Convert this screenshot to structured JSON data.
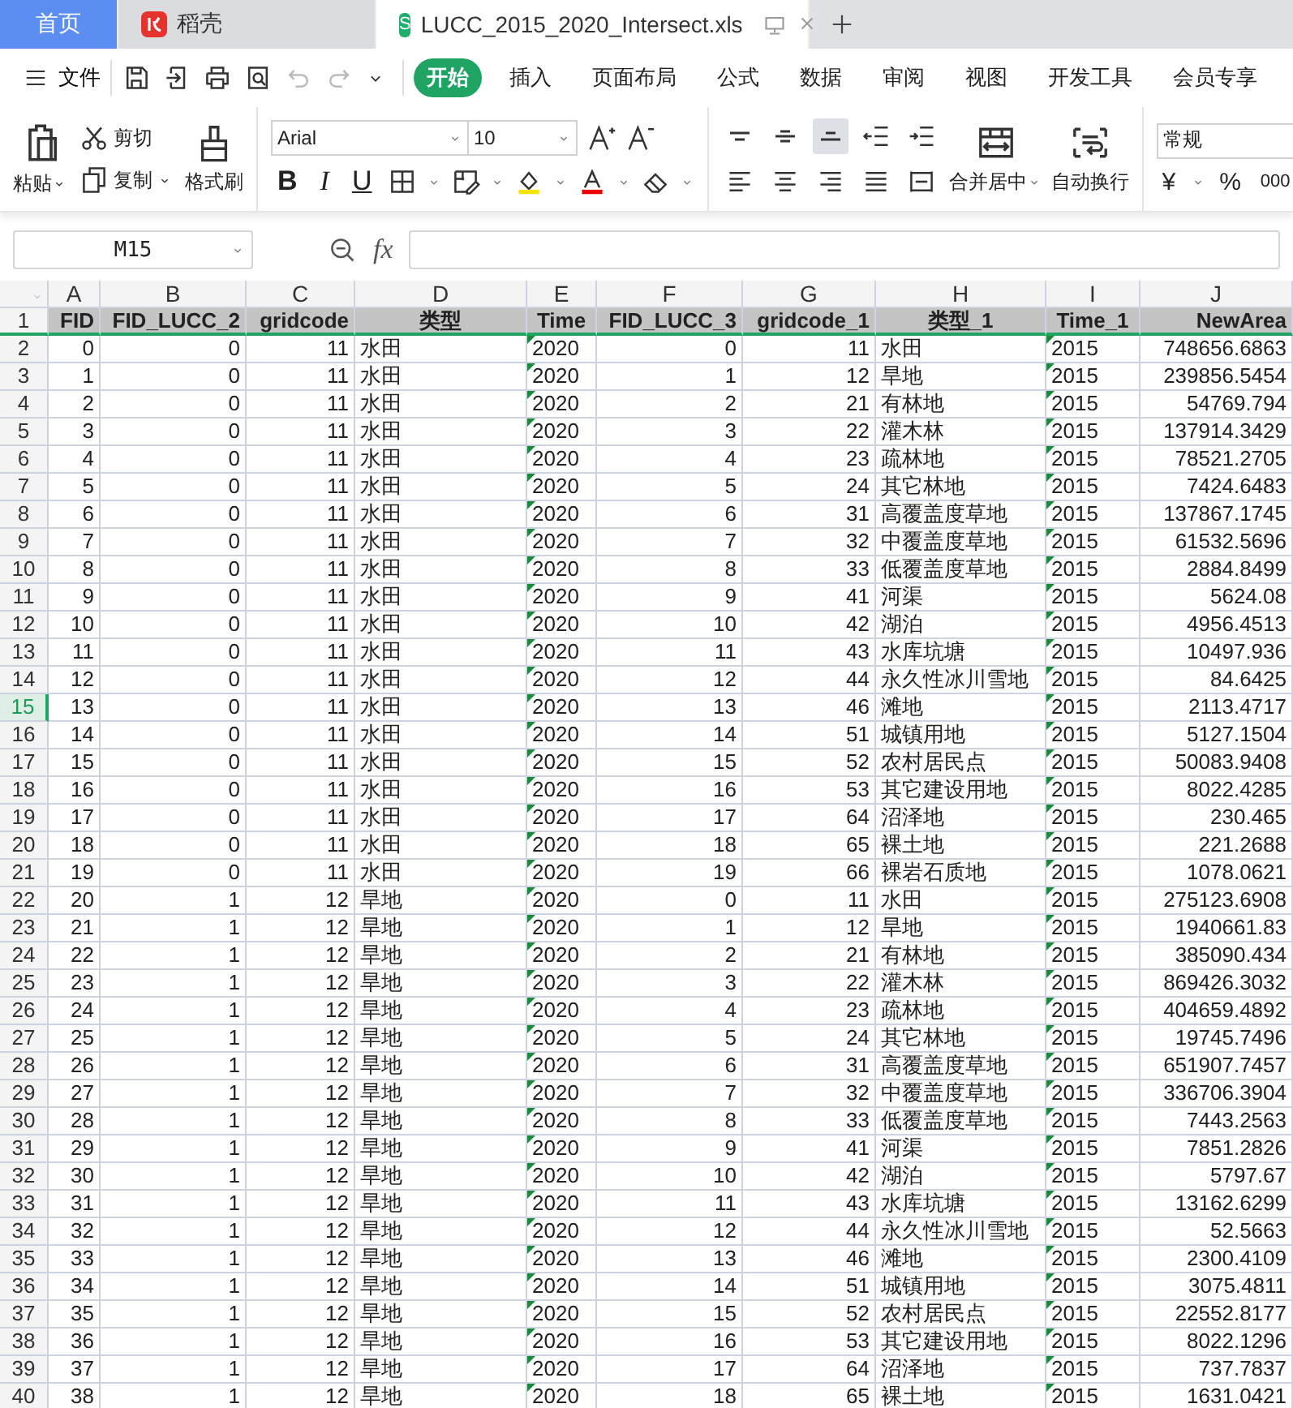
{
  "tabs": [
    {
      "label": "首页",
      "kind": "home",
      "selected": false
    },
    {
      "label": "稻壳",
      "kind": "app",
      "selected": false
    },
    {
      "label": "LUCC_2015_2020_Intersect.xls",
      "kind": "file",
      "badge": "S",
      "selected": true
    }
  ],
  "menu": {
    "file_label": "文件",
    "items": [
      {
        "label": "开始",
        "selected": true
      },
      {
        "label": "插入",
        "selected": false
      },
      {
        "label": "页面布局",
        "selected": false
      },
      {
        "label": "公式",
        "selected": false
      },
      {
        "label": "数据",
        "selected": false
      },
      {
        "label": "审阅",
        "selected": false
      },
      {
        "label": "视图",
        "selected": false
      },
      {
        "label": "开发工具",
        "selected": false
      },
      {
        "label": "会员专享",
        "selected": false
      }
    ]
  },
  "ribbon": {
    "paste": "粘贴",
    "cut": "剪切",
    "copy": "复制",
    "format_painter": "格式刷",
    "font": "Arial",
    "size": "10",
    "style_buttons": [
      "B",
      "I",
      "U"
    ],
    "align_buttons": [
      {
        "kind": "top",
        "on": false
      },
      {
        "kind": "middle",
        "on": false
      },
      {
        "kind": "bottom",
        "on": true
      },
      {
        "kind": "outdent",
        "on": false
      },
      {
        "kind": "indent",
        "on": false
      }
    ],
    "merge": "合并居中",
    "wrap": "自动换行",
    "number_format": "常规",
    "currency": "¥",
    "percent": "%",
    "thousands": "000"
  },
  "formula_bar": {
    "name_box": "M15",
    "fx_label": "fx"
  },
  "sheet": {
    "columns": [
      {
        "letter": "A",
        "header": "FID",
        "kind": "number"
      },
      {
        "letter": "B",
        "header": "FID_LUCC_2",
        "kind": "number"
      },
      {
        "letter": "C",
        "header": "gridcode",
        "kind": "number"
      },
      {
        "letter": "D",
        "header": "类型",
        "kind": "text"
      },
      {
        "letter": "E",
        "header": "Time",
        "kind": "text_number"
      },
      {
        "letter": "F",
        "header": "FID_LUCC_3",
        "kind": "number"
      },
      {
        "letter": "G",
        "header": "gridcode_1",
        "kind": "number"
      },
      {
        "letter": "H",
        "header": "类型_1",
        "kind": "text"
      },
      {
        "letter": "I",
        "header": "Time_1",
        "kind": "text_number"
      },
      {
        "letter": "J",
        "header": "NewArea",
        "kind": "number"
      }
    ],
    "header_row_number": "1",
    "rows": [
      {
        "number": "2",
        "selected": false,
        "cells": [
          "0",
          "0",
          "11",
          "水田",
          "2020",
          "0",
          "11",
          "水田",
          "2015",
          "748656.6863"
        ]
      },
      {
        "number": "3",
        "selected": false,
        "cells": [
          "1",
          "0",
          "11",
          "水田",
          "2020",
          "1",
          "12",
          "旱地",
          "2015",
          "239856.5454"
        ]
      },
      {
        "number": "4",
        "selected": false,
        "cells": [
          "2",
          "0",
          "11",
          "水田",
          "2020",
          "2",
          "21",
          "有林地",
          "2015",
          "54769.794"
        ]
      },
      {
        "number": "5",
        "selected": false,
        "cells": [
          "3",
          "0",
          "11",
          "水田",
          "2020",
          "3",
          "22",
          "灌木林",
          "2015",
          "137914.3429"
        ]
      },
      {
        "number": "6",
        "selected": false,
        "cells": [
          "4",
          "0",
          "11",
          "水田",
          "2020",
          "4",
          "23",
          "疏林地",
          "2015",
          "78521.2705"
        ]
      },
      {
        "number": "7",
        "selected": false,
        "cells": [
          "5",
          "0",
          "11",
          "水田",
          "2020",
          "5",
          "24",
          "其它林地",
          "2015",
          "7424.6483"
        ]
      },
      {
        "number": "8",
        "selected": false,
        "cells": [
          "6",
          "0",
          "11",
          "水田",
          "2020",
          "6",
          "31",
          "高覆盖度草地",
          "2015",
          "137867.1745"
        ]
      },
      {
        "number": "9",
        "selected": false,
        "cells": [
          "7",
          "0",
          "11",
          "水田",
          "2020",
          "7",
          "32",
          "中覆盖度草地",
          "2015",
          "61532.5696"
        ]
      },
      {
        "number": "10",
        "selected": false,
        "cells": [
          "8",
          "0",
          "11",
          "水田",
          "2020",
          "8",
          "33",
          "低覆盖度草地",
          "2015",
          "2884.8499"
        ]
      },
      {
        "number": "11",
        "selected": false,
        "cells": [
          "9",
          "0",
          "11",
          "水田",
          "2020",
          "9",
          "41",
          "河渠",
          "2015",
          "5624.08"
        ]
      },
      {
        "number": "12",
        "selected": false,
        "cells": [
          "10",
          "0",
          "11",
          "水田",
          "2020",
          "10",
          "42",
          "湖泊",
          "2015",
          "4956.4513"
        ]
      },
      {
        "number": "13",
        "selected": false,
        "cells": [
          "11",
          "0",
          "11",
          "水田",
          "2020",
          "11",
          "43",
          "水库坑塘",
          "2015",
          "10497.936"
        ]
      },
      {
        "number": "14",
        "selected": false,
        "cells": [
          "12",
          "0",
          "11",
          "水田",
          "2020",
          "12",
          "44",
          "永久性冰川雪地",
          "2015",
          "84.6425"
        ]
      },
      {
        "number": "15",
        "selected": true,
        "cells": [
          "13",
          "0",
          "11",
          "水田",
          "2020",
          "13",
          "46",
          "滩地",
          "2015",
          "2113.4717"
        ]
      },
      {
        "number": "16",
        "selected": false,
        "cells": [
          "14",
          "0",
          "11",
          "水田",
          "2020",
          "14",
          "51",
          "城镇用地",
          "2015",
          "5127.1504"
        ]
      },
      {
        "number": "17",
        "selected": false,
        "cells": [
          "15",
          "0",
          "11",
          "水田",
          "2020",
          "15",
          "52",
          "农村居民点",
          "2015",
          "50083.9408"
        ]
      },
      {
        "number": "18",
        "selected": false,
        "cells": [
          "16",
          "0",
          "11",
          "水田",
          "2020",
          "16",
          "53",
          "其它建设用地",
          "2015",
          "8022.4285"
        ]
      },
      {
        "number": "19",
        "selected": false,
        "cells": [
          "17",
          "0",
          "11",
          "水田",
          "2020",
          "17",
          "64",
          "沼泽地",
          "2015",
          "230.465"
        ]
      },
      {
        "number": "20",
        "selected": false,
        "cells": [
          "18",
          "0",
          "11",
          "水田",
          "2020",
          "18",
          "65",
          "裸土地",
          "2015",
          "221.2688"
        ]
      },
      {
        "number": "21",
        "selected": false,
        "cells": [
          "19",
          "0",
          "11",
          "水田",
          "2020",
          "19",
          "66",
          "裸岩石质地",
          "2015",
          "1078.0621"
        ]
      },
      {
        "number": "22",
        "selected": false,
        "cells": [
          "20",
          "1",
          "12",
          "旱地",
          "2020",
          "0",
          "11",
          "水田",
          "2015",
          "275123.6908"
        ]
      },
      {
        "number": "23",
        "selected": false,
        "cells": [
          "21",
          "1",
          "12",
          "旱地",
          "2020",
          "1",
          "12",
          "旱地",
          "2015",
          "1940661.83"
        ]
      },
      {
        "number": "24",
        "selected": false,
        "cells": [
          "22",
          "1",
          "12",
          "旱地",
          "2020",
          "2",
          "21",
          "有林地",
          "2015",
          "385090.434"
        ]
      },
      {
        "number": "25",
        "selected": false,
        "cells": [
          "23",
          "1",
          "12",
          "旱地",
          "2020",
          "3",
          "22",
          "灌木林",
          "2015",
          "869426.3032"
        ]
      },
      {
        "number": "26",
        "selected": false,
        "cells": [
          "24",
          "1",
          "12",
          "旱地",
          "2020",
          "4",
          "23",
          "疏林地",
          "2015",
          "404659.4892"
        ]
      },
      {
        "number": "27",
        "selected": false,
        "cells": [
          "25",
          "1",
          "12",
          "旱地",
          "2020",
          "5",
          "24",
          "其它林地",
          "2015",
          "19745.7496"
        ]
      },
      {
        "number": "28",
        "selected": false,
        "cells": [
          "26",
          "1",
          "12",
          "旱地",
          "2020",
          "6",
          "31",
          "高覆盖度草地",
          "2015",
          "651907.7457"
        ]
      },
      {
        "number": "29",
        "selected": false,
        "cells": [
          "27",
          "1",
          "12",
          "旱地",
          "2020",
          "7",
          "32",
          "中覆盖度草地",
          "2015",
          "336706.3904"
        ]
      },
      {
        "number": "30",
        "selected": false,
        "cells": [
          "28",
          "1",
          "12",
          "旱地",
          "2020",
          "8",
          "33",
          "低覆盖度草地",
          "2015",
          "7443.2563"
        ]
      },
      {
        "number": "31",
        "selected": false,
        "cells": [
          "29",
          "1",
          "12",
          "旱地",
          "2020",
          "9",
          "41",
          "河渠",
          "2015",
          "7851.2826"
        ]
      },
      {
        "number": "32",
        "selected": false,
        "cells": [
          "30",
          "1",
          "12",
          "旱地",
          "2020",
          "10",
          "42",
          "湖泊",
          "2015",
          "5797.67"
        ]
      },
      {
        "number": "33",
        "selected": false,
        "cells": [
          "31",
          "1",
          "12",
          "旱地",
          "2020",
          "11",
          "43",
          "水库坑塘",
          "2015",
          "13162.6299"
        ]
      },
      {
        "number": "34",
        "selected": false,
        "cells": [
          "32",
          "1",
          "12",
          "旱地",
          "2020",
          "12",
          "44",
          "永久性冰川雪地",
          "2015",
          "52.5663"
        ]
      },
      {
        "number": "35",
        "selected": false,
        "cells": [
          "33",
          "1",
          "12",
          "旱地",
          "2020",
          "13",
          "46",
          "滩地",
          "2015",
          "2300.4109"
        ]
      },
      {
        "number": "36",
        "selected": false,
        "cells": [
          "34",
          "1",
          "12",
          "旱地",
          "2020",
          "14",
          "51",
          "城镇用地",
          "2015",
          "3075.4811"
        ]
      },
      {
        "number": "37",
        "selected": false,
        "cells": [
          "35",
          "1",
          "12",
          "旱地",
          "2020",
          "15",
          "52",
          "农村居民点",
          "2015",
          "22552.8177"
        ]
      },
      {
        "number": "38",
        "selected": false,
        "cells": [
          "36",
          "1",
          "12",
          "旱地",
          "2020",
          "16",
          "53",
          "其它建设用地",
          "2015",
          "8022.1296"
        ]
      },
      {
        "number": "39",
        "selected": false,
        "cells": [
          "37",
          "1",
          "12",
          "旱地",
          "2020",
          "17",
          "64",
          "沼泽地",
          "2015",
          "737.7837"
        ]
      },
      {
        "number": "40",
        "selected": false,
        "cells": [
          "38",
          "1",
          "12",
          "旱地",
          "2020",
          "18",
          "65",
          "裸土地",
          "2015",
          "1631.0421"
        ]
      }
    ]
  }
}
